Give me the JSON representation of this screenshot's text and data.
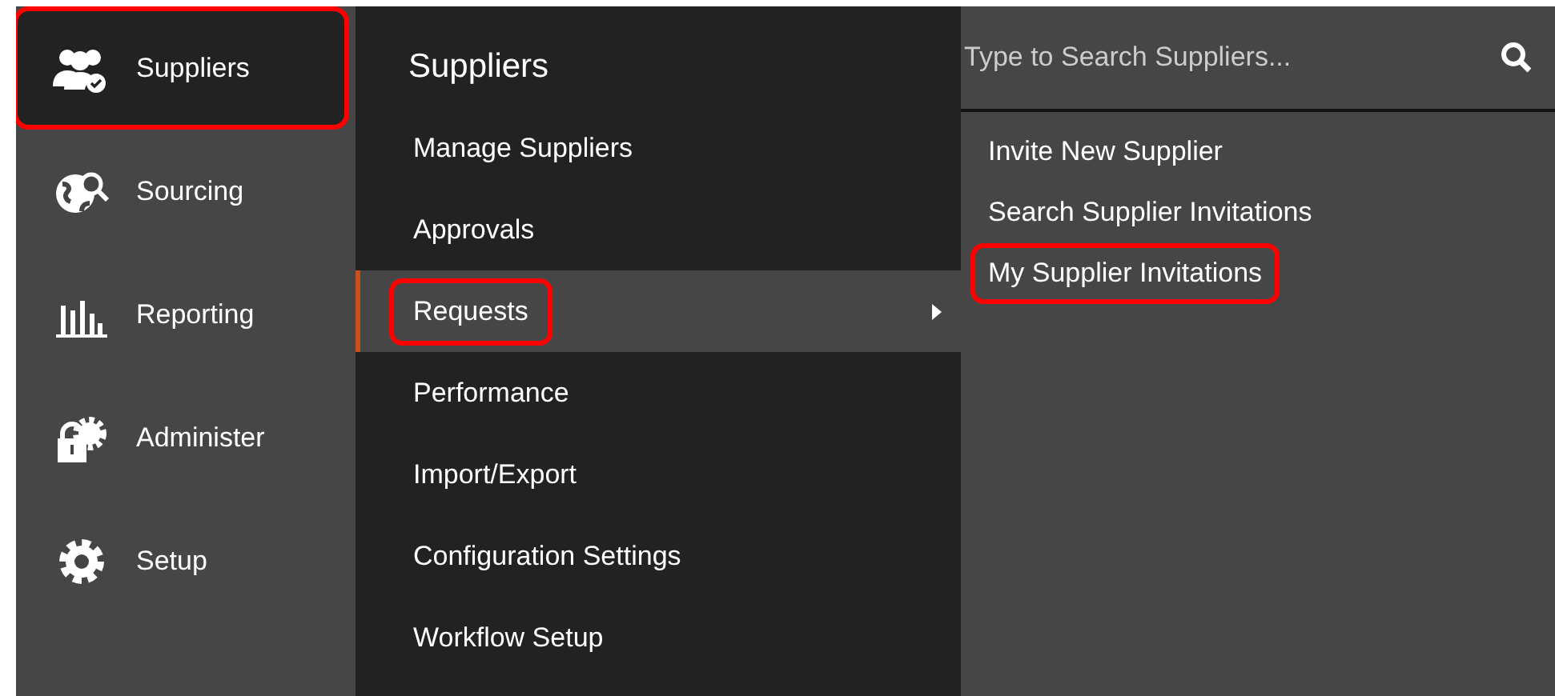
{
  "nav": [
    {
      "label": "Suppliers",
      "selected": true,
      "highlighted": true
    },
    {
      "label": "Sourcing",
      "selected": false,
      "highlighted": false
    },
    {
      "label": "Reporting",
      "selected": false,
      "highlighted": false
    },
    {
      "label": "Administer",
      "selected": false,
      "highlighted": false
    },
    {
      "label": "Setup",
      "selected": false,
      "highlighted": false
    }
  ],
  "submenu": {
    "title": "Suppliers",
    "items": [
      {
        "label": "Manage Suppliers",
        "selected": false,
        "highlighted": false,
        "has_children": false
      },
      {
        "label": "Approvals",
        "selected": false,
        "highlighted": false,
        "has_children": false
      },
      {
        "label": "Requests",
        "selected": true,
        "highlighted": true,
        "has_children": true
      },
      {
        "label": "Performance",
        "selected": false,
        "highlighted": false,
        "has_children": false
      },
      {
        "label": "Import/Export",
        "selected": false,
        "highlighted": false,
        "has_children": false
      },
      {
        "label": "Configuration Settings",
        "selected": false,
        "highlighted": false,
        "has_children": false
      },
      {
        "label": "Workflow Setup",
        "selected": false,
        "highlighted": false,
        "has_children": false
      }
    ]
  },
  "flyout": {
    "search": {
      "placeholder": "Type to Search Suppliers..."
    },
    "items": [
      {
        "label": "Invite New Supplier",
        "highlighted": false
      },
      {
        "label": "Search Supplier Invitations",
        "highlighted": false
      },
      {
        "label": "My Supplier Invitations",
        "highlighted": true
      }
    ]
  }
}
